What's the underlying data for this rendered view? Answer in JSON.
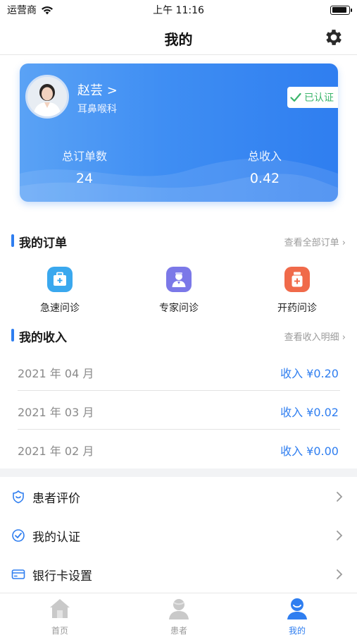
{
  "status_bar": {
    "carrier": "运营商",
    "time": "上午 11:16",
    "battery_level": 0.9
  },
  "nav": {
    "title": "我的"
  },
  "profile": {
    "name": "赵芸 >",
    "department": "耳鼻喉科",
    "verified_label": "已认证",
    "stats": [
      {
        "label": "总订单数",
        "value": "24"
      },
      {
        "label": "总收入",
        "value": "0.42"
      }
    ]
  },
  "orders": {
    "title": "我的订单",
    "link": "查看全部订单 ›",
    "items": [
      {
        "label": "急速问诊",
        "icon": "medical-kit-icon",
        "color": "#3aa8ee"
      },
      {
        "label": "专家问诊",
        "icon": "doctor-icon",
        "color": "#7b78e8"
      },
      {
        "label": "开药问诊",
        "icon": "medicine-bottle-icon",
        "color": "#f06a4a"
      }
    ]
  },
  "income": {
    "title": "我的收入",
    "link": "查看收入明细 ›",
    "rows": [
      {
        "month": "2021 年 04 月",
        "amount": "收入 ¥0.20"
      },
      {
        "month": "2021 年 03 月",
        "amount": "收入 ¥0.02"
      },
      {
        "month": "2021 年 02 月",
        "amount": "收入 ¥0.00"
      }
    ]
  },
  "menu": {
    "items": [
      {
        "label": "患者评价",
        "icon": "rating-icon"
      },
      {
        "label": "我的认证",
        "icon": "check-circle-icon"
      },
      {
        "label": "银行卡设置",
        "icon": "bank-card-icon"
      }
    ]
  },
  "tabs": [
    {
      "label": "首页",
      "icon": "home-icon"
    },
    {
      "label": "患者",
      "icon": "patient-icon"
    },
    {
      "label": "我的",
      "icon": "user-icon",
      "active": true
    }
  ],
  "colors": {
    "accent": "#2f7ef0",
    "verified": "#3bb56b"
  }
}
